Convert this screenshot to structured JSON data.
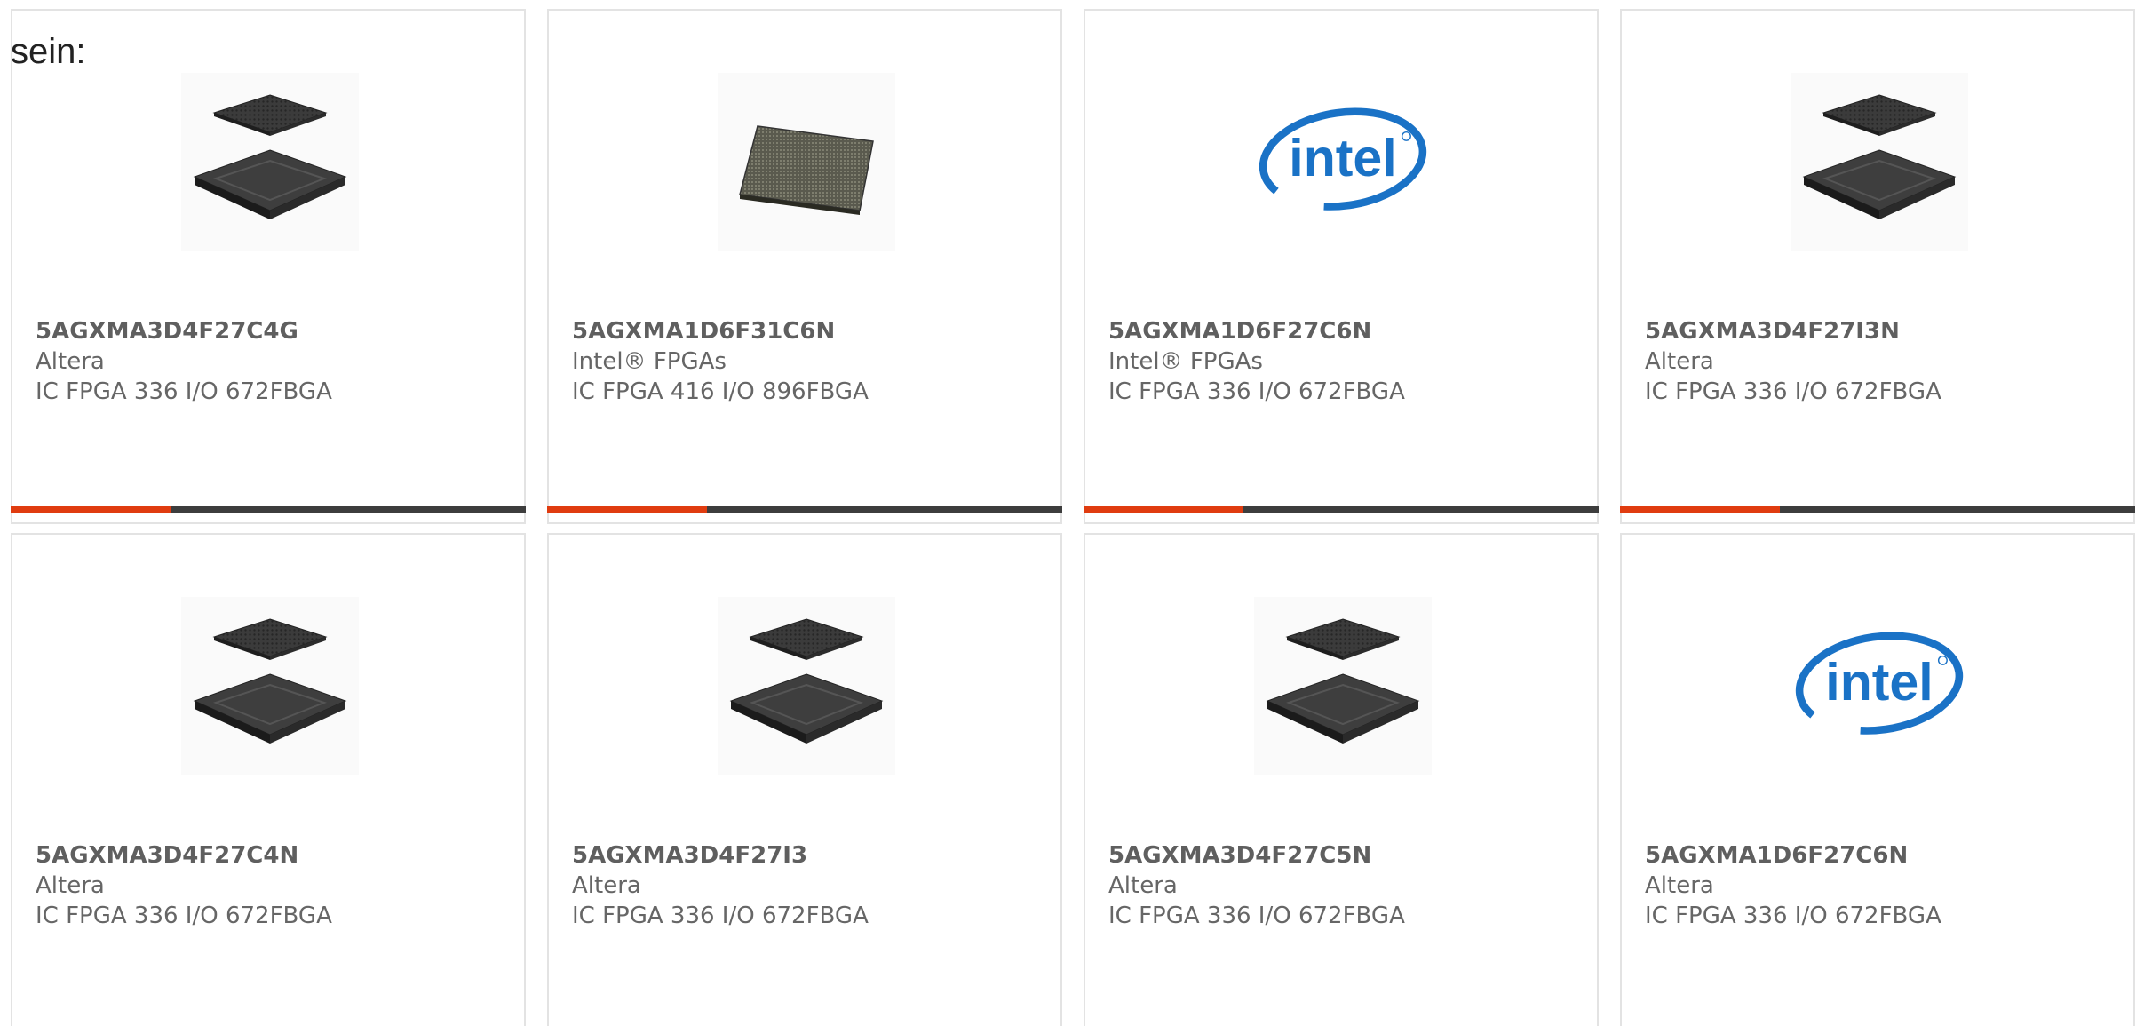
{
  "intro_text": "sein:",
  "colors": {
    "progress_fill": "#e03c10",
    "progress_track": "#3d3d3d",
    "intel_blue": "#1a72c6"
  },
  "cards": [
    {
      "part": "5AGXMA3D4F27C4G",
      "manufacturer": "Altera",
      "description": "IC FPGA 336 I/O 672FBGA",
      "image": "bga-chip-stacked-image",
      "progress": 0.31
    },
    {
      "part": "5AGXMA1D6F31C6N",
      "manufacturer": "Intel® FPGAs",
      "description": "IC FPGA 416 I/O 896FBGA",
      "image": "bga-chip-single-image",
      "progress": 0.31
    },
    {
      "part": "5AGXMA1D6F27C6N",
      "manufacturer": "Intel® FPGAs",
      "description": "IC FPGA 336 I/O 672FBGA",
      "image": "intel-logo",
      "progress": 0.31
    },
    {
      "part": "5AGXMA3D4F27I3N",
      "manufacturer": "Altera",
      "description": "IC FPGA 336 I/O 672FBGA",
      "image": "bga-chip-stacked-image",
      "progress": 0.31
    },
    {
      "part": "5AGXMA3D4F27C4N",
      "manufacturer": "Altera",
      "description": "IC FPGA 336 I/O 672FBGA",
      "image": "bga-chip-stacked-image"
    },
    {
      "part": "5AGXMA3D4F27I3",
      "manufacturer": "Altera",
      "description": "IC FPGA 336 I/O 672FBGA",
      "image": "bga-chip-stacked-image"
    },
    {
      "part": "5AGXMA3D4F27C5N",
      "manufacturer": "Altera",
      "description": "IC FPGA 336 I/O 672FBGA",
      "image": "bga-chip-stacked-image"
    },
    {
      "part": "5AGXMA1D6F27C6N",
      "manufacturer": "Altera",
      "description": "IC FPGA 336 I/O 672FBGA",
      "image": "intel-logo"
    }
  ]
}
